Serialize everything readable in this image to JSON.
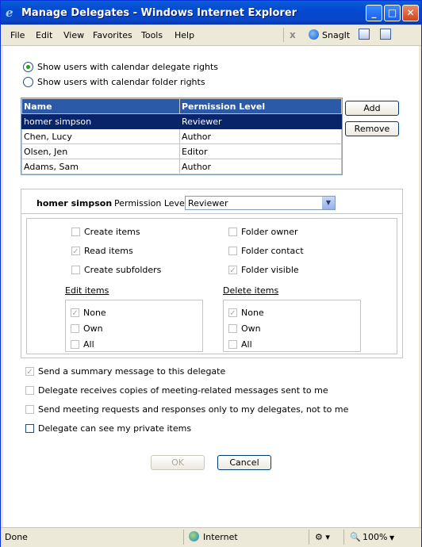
{
  "window": {
    "title": "Manage Delegates - Windows Internet Explorer",
    "minimize": "_",
    "maximize": "□",
    "close": "✕",
    "icon": "ie-icon"
  },
  "menubar": {
    "items": [
      "File",
      "Edit",
      "View",
      "Favorites",
      "Tools",
      "Help"
    ],
    "close_glyph": "x",
    "snagit": "SnagIt"
  },
  "options": {
    "delegate_rights": "Show users with calendar delegate rights",
    "folder_rights": "Show users with calendar folder rights",
    "selected": "delegate_rights"
  },
  "delegates": {
    "columns": [
      "Name",
      "Permission Level"
    ],
    "rows": [
      {
        "name": "homer simpson",
        "level": "Reviewer",
        "selected": true
      },
      {
        "name": "Chen, Lucy",
        "level": "Author"
      },
      {
        "name": "Olsen, Jen",
        "level": "Editor"
      },
      {
        "name": "Adams, Sam",
        "level": "Author"
      }
    ],
    "add_label": "Add",
    "remove_label": "Remove"
  },
  "details": {
    "name": "homer simpson",
    "permission_label": "Permission Level",
    "permission_value": "Reviewer",
    "create_items": "Create items",
    "read_items": "Read items",
    "create_subfolders": "Create subfolders",
    "folder_owner": "Folder owner",
    "folder_contact": "Folder contact",
    "folder_visible": "Folder visible",
    "edit_items_label": "Edit items",
    "delete_items_label": "Delete items",
    "edit_options": [
      "None",
      "Own",
      "All"
    ],
    "delete_options": [
      "None",
      "Own",
      "All"
    ],
    "checked": {
      "read_items": true,
      "folder_visible": true,
      "edit_none": true,
      "delete_none": true
    }
  },
  "settings": {
    "summary": "Send a summary message to this delegate",
    "copies": "Delegate receives copies of meeting-related messages sent to me",
    "requests_only": "Send meeting requests and responses only to my delegates, not to me",
    "private_items": "Delegate can see my private items",
    "checked": {
      "summary": true
    }
  },
  "footer": {
    "ok_label": "OK",
    "cancel_label": "Cancel"
  },
  "statusbar": {
    "status": "Done",
    "zone": "Internet",
    "zoom": "100%"
  }
}
